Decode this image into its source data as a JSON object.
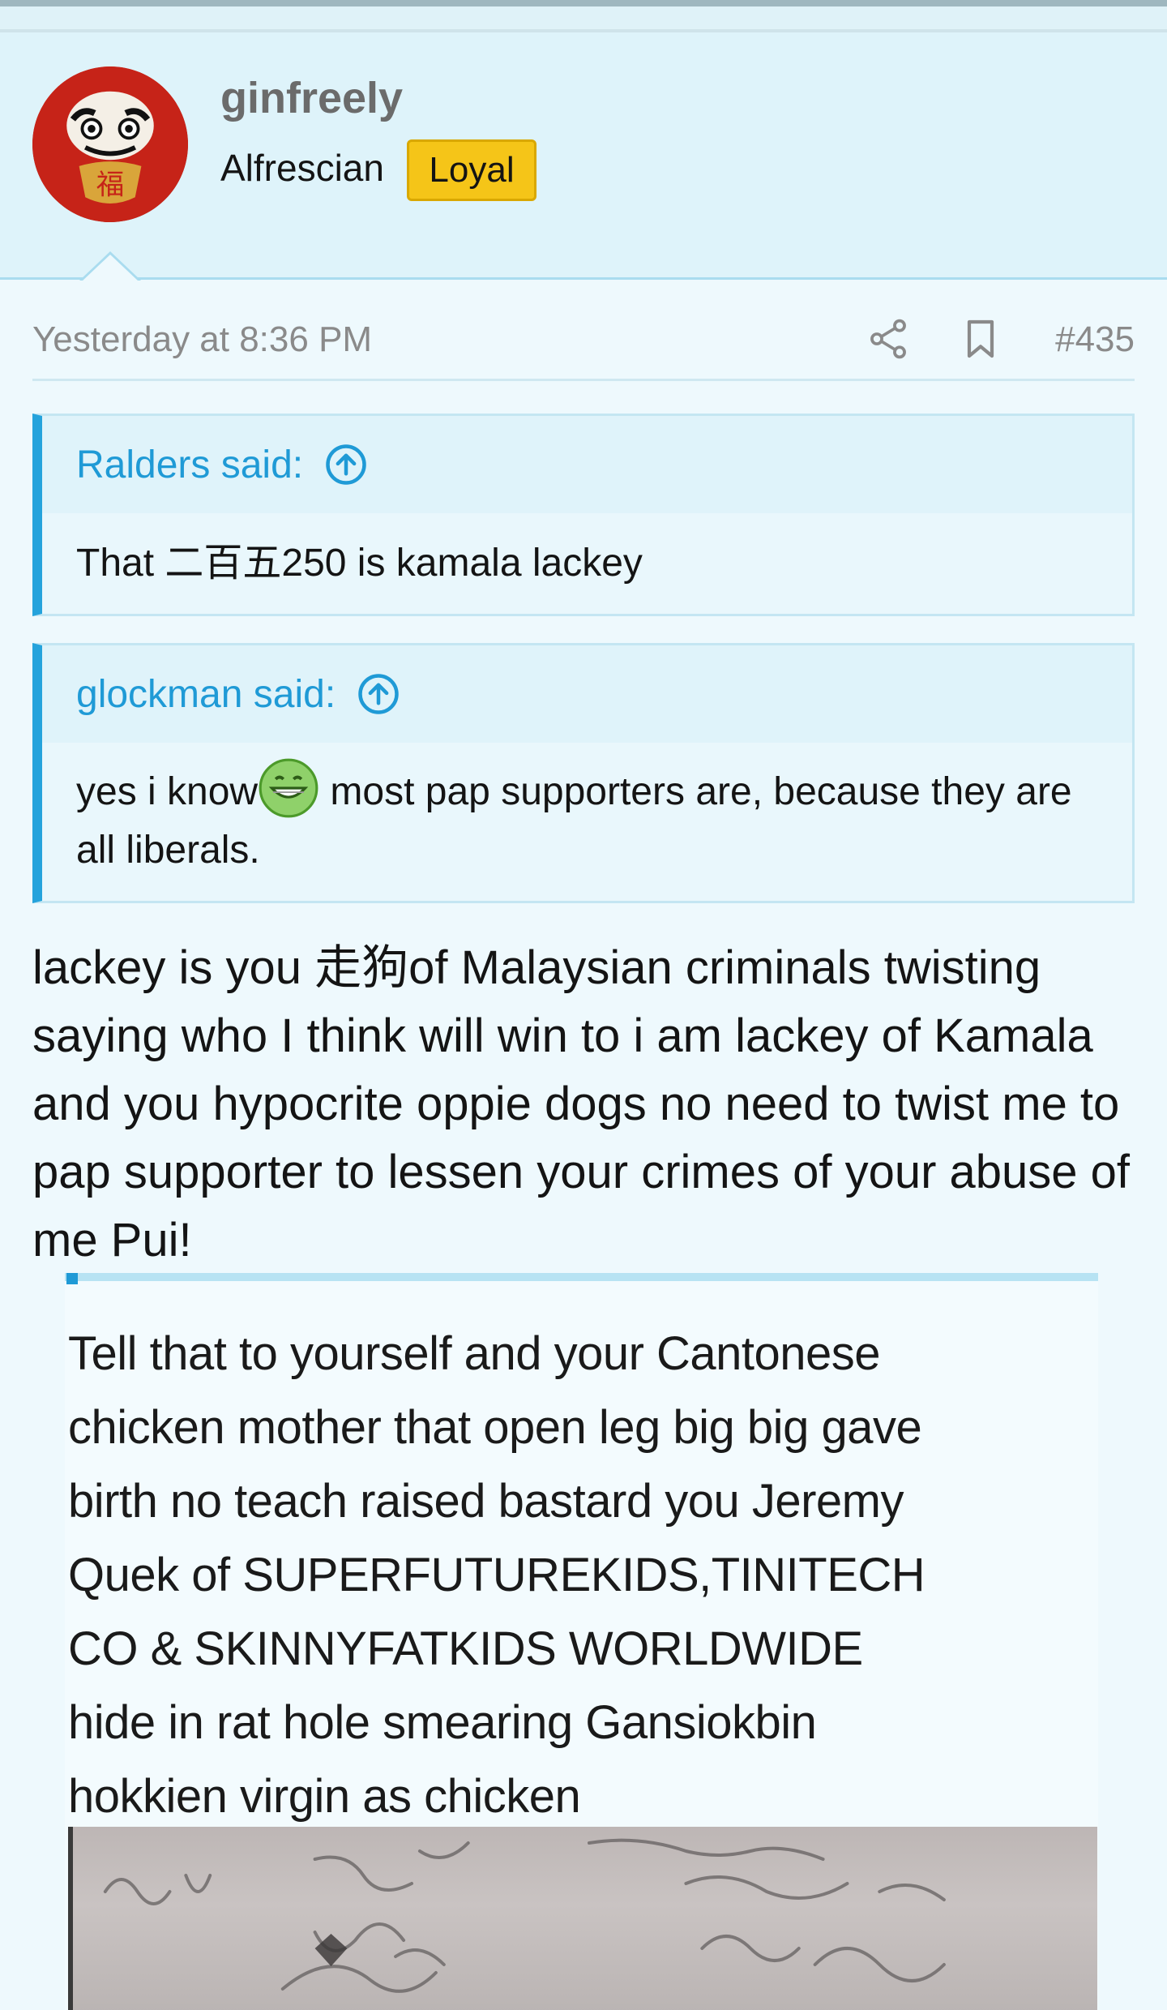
{
  "user": {
    "name": "ginfreely",
    "title": "Alfrescian",
    "badge": "Loyal",
    "avatar_icon": "daruma-avatar-icon"
  },
  "post": {
    "timestamp": "Yesterday at 8:36 PM",
    "number": "#435",
    "actions": [
      "share-icon",
      "bookmark-icon"
    ]
  },
  "quotes": [
    {
      "author_label": "Ralders said:",
      "text": "That 二百五250 is kamala lackey"
    },
    {
      "author_label": "glockman said:",
      "text_before_emoji": "yes i know",
      "emoji": "grinning-face-emoji",
      "text_after_emoji": " most pap supporters are, because they are all liberals."
    }
  ],
  "body_text": "lackey is you 走狗of Malaysian criminals twisting saying who I think will win to i am lackey of Kamala and you hypocrite oppie dogs no need to twist me to pap supporter to lessen your crimes of your abuse of me Pui!",
  "embedded_image": {
    "text_lines": [
      "Tell that to yourself and your Cantonese",
      "chicken mother that open leg big big gave",
      "birth no teach raised bastard you Jeremy",
      "Quek of SUPERFUTUREKIDS,TINITECH",
      "CO & SKINNYFATKIDS WORLDWIDE",
      "hide in rat hole smearing Gansiokbin",
      "hokkien virgin as chicken"
    ]
  },
  "colors": {
    "accent": "#1f9ad6",
    "badge": "#f5c518",
    "header_bg": "#def3fa",
    "page_bg": "#eef9fd"
  }
}
